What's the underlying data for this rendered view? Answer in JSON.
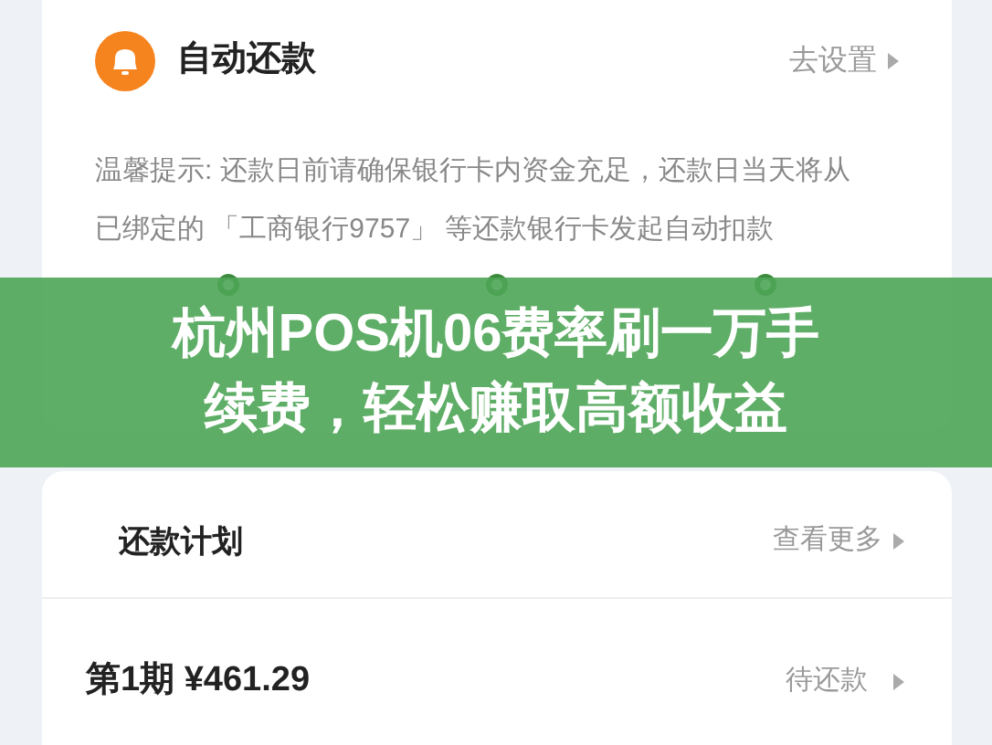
{
  "auto_repay": {
    "title": "自动还款",
    "action": "去设置",
    "tip_lines": [
      "温馨提示: 还款日前请确保银行卡内资金充足，还款日当天将从",
      "已绑定的 「工商银行9757」 等还款银行卡发起自动扣款"
    ],
    "steps": [
      {
        "kind": "step"
      },
      {
        "kind": "step"
      },
      {
        "kind": "step"
      }
    ]
  },
  "banner": {
    "lines": [
      "杭州POS机06费率刷一万手",
      "续费，轻松赚取高额收益"
    ]
  },
  "plan": {
    "title": "还款计划",
    "action": "查看更多",
    "installments": [
      {
        "label": "第1期 ¥461.29",
        "status": "待还款"
      }
    ]
  }
}
